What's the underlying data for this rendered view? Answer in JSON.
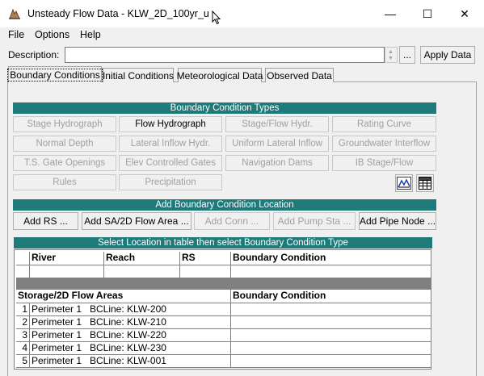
{
  "window": {
    "title": "Unsteady Flow Data - KLW_2D_100yr_u",
    "minimize": "—",
    "maximize": "☐",
    "close": "✕"
  },
  "menu": [
    "File",
    "Options",
    "Help"
  ],
  "description": {
    "label": "Description:",
    "value": "",
    "ellipsis_label": "...",
    "apply_label": "Apply Data"
  },
  "tabs": [
    {
      "label": "Boundary Conditions",
      "active": true
    },
    {
      "label": "Initial Conditions",
      "active": false
    },
    {
      "label": "Meteorological Data",
      "active": false
    },
    {
      "label": "Observed Data",
      "active": false
    }
  ],
  "bc_types": {
    "header": "Boundary Condition Types",
    "buttons": [
      {
        "label": "Stage Hydrograph",
        "enabled": false
      },
      {
        "label": "Flow Hydrograph",
        "enabled": true
      },
      {
        "label": "Stage/Flow Hydr.",
        "enabled": false
      },
      {
        "label": "Rating Curve",
        "enabled": false
      },
      {
        "label": "Normal Depth",
        "enabled": false
      },
      {
        "label": "Lateral Inflow Hydr.",
        "enabled": false
      },
      {
        "label": "Uniform Lateral Inflow",
        "enabled": false
      },
      {
        "label": "Groundwater Interflow",
        "enabled": false
      },
      {
        "label": "T.S. Gate Openings",
        "enabled": false
      },
      {
        "label": "Elev Controlled Gates",
        "enabled": false
      },
      {
        "label": "Navigation Dams",
        "enabled": false
      },
      {
        "label": "IB Stage/Flow",
        "enabled": false
      },
      {
        "label": "Rules",
        "enabled": false
      },
      {
        "label": "Precipitation",
        "enabled": false
      }
    ],
    "icons": [
      "hydrograph-plot-icon",
      "table-grid-icon"
    ]
  },
  "add_location": {
    "header": "Add Boundary Condition Location",
    "buttons": [
      {
        "label": "Add RS ...",
        "enabled": true
      },
      {
        "label": "Add SA/2D Flow Area ...",
        "enabled": true
      },
      {
        "label": "Add Conn ...",
        "enabled": false
      },
      {
        "label": "Add Pump Sta ...",
        "enabled": false
      },
      {
        "label": "Add Pipe Node ...",
        "enabled": true
      }
    ]
  },
  "location_table": {
    "header": "Select Location in table then select Boundary Condition Type",
    "river_columns": [
      "River",
      "Reach",
      "RS",
      "Boundary Condition"
    ],
    "storage_columns": [
      "Storage/2D Flow Areas",
      "Boundary Condition"
    ],
    "rows": [
      {
        "num": "1",
        "area": "Perimeter 1",
        "bcline": "BCLine: KLW-200",
        "bc": ""
      },
      {
        "num": "2",
        "area": "Perimeter 1",
        "bcline": "BCLine: KLW-210",
        "bc": ""
      },
      {
        "num": "3",
        "area": "Perimeter 1",
        "bcline": "BCLine: KLW-220",
        "bc": ""
      },
      {
        "num": "4",
        "area": "Perimeter 1",
        "bcline": "BCLine: KLW-230",
        "bc": ""
      },
      {
        "num": "5",
        "area": "Perimeter 1",
        "bcline": "BCLine: KLW-001",
        "bc": ""
      }
    ]
  },
  "colors": {
    "header_teal": "#1f7a7a",
    "disabled_text": "#a0a0a0"
  }
}
